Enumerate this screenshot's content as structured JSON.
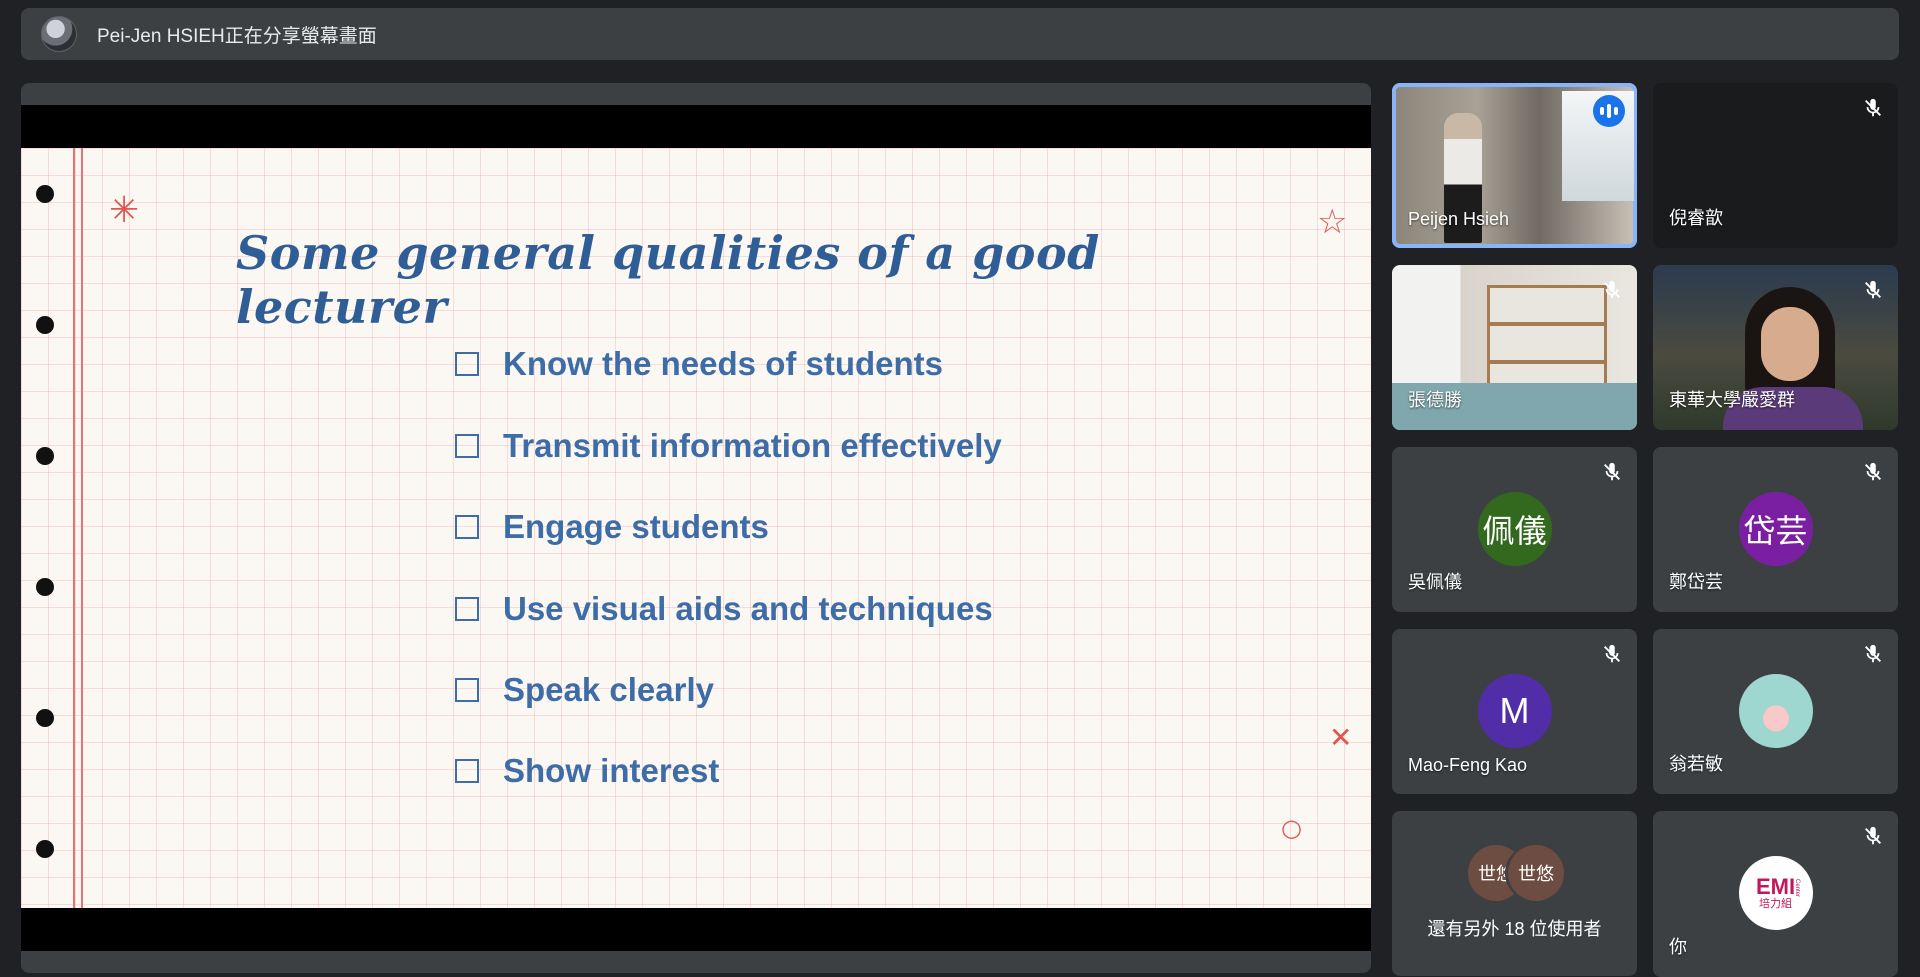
{
  "presenter_bar": {
    "title": "Pei-Jen HSIEH正在分享螢幕畫面",
    "avatar_icon": "user-avatar"
  },
  "slide": {
    "title": "Some general qualities of a good lecturer",
    "items": [
      "Know the needs of students",
      "Transmit information effectively",
      "Engage students",
      "Use visual aids and techniques",
      "Speak clearly",
      "Show interest"
    ],
    "decorations": [
      "✳",
      "☆",
      "✕",
      "○"
    ]
  },
  "participants": [
    {
      "name": "Peijen Hsieh",
      "status": "speaking"
    },
    {
      "name": "倪睿歆",
      "status": "muted"
    },
    {
      "name": "張德勝",
      "status": "muted"
    },
    {
      "name": "東華大學嚴愛群",
      "status": "muted"
    },
    {
      "name": "吳佩儀",
      "initials": "佩儀",
      "avatar_color": "#33691e",
      "status": "muted"
    },
    {
      "name": "鄭岱芸",
      "initials": "岱芸",
      "avatar_color": "#7b1fa2",
      "status": "muted"
    },
    {
      "name": "Mao-Feng Kao",
      "initials": "M",
      "avatar_color": "#512da8",
      "status": "muted"
    },
    {
      "name": "翁若敏",
      "status": "muted"
    },
    {
      "name": "還有另外 18 位使用者",
      "avatar_a": "世悠",
      "avatar_b": "世悠"
    },
    {
      "name": "你",
      "logo_text": "EMI",
      "logo_sub": "培力組",
      "logo_side": "Center",
      "status": "muted"
    }
  ],
  "colors": {
    "background": "#202124",
    "tile": "#3c4043",
    "active_outline": "#8ab4f8",
    "slide_text": "#3d6ca6",
    "accent_red": "#e0564f"
  }
}
